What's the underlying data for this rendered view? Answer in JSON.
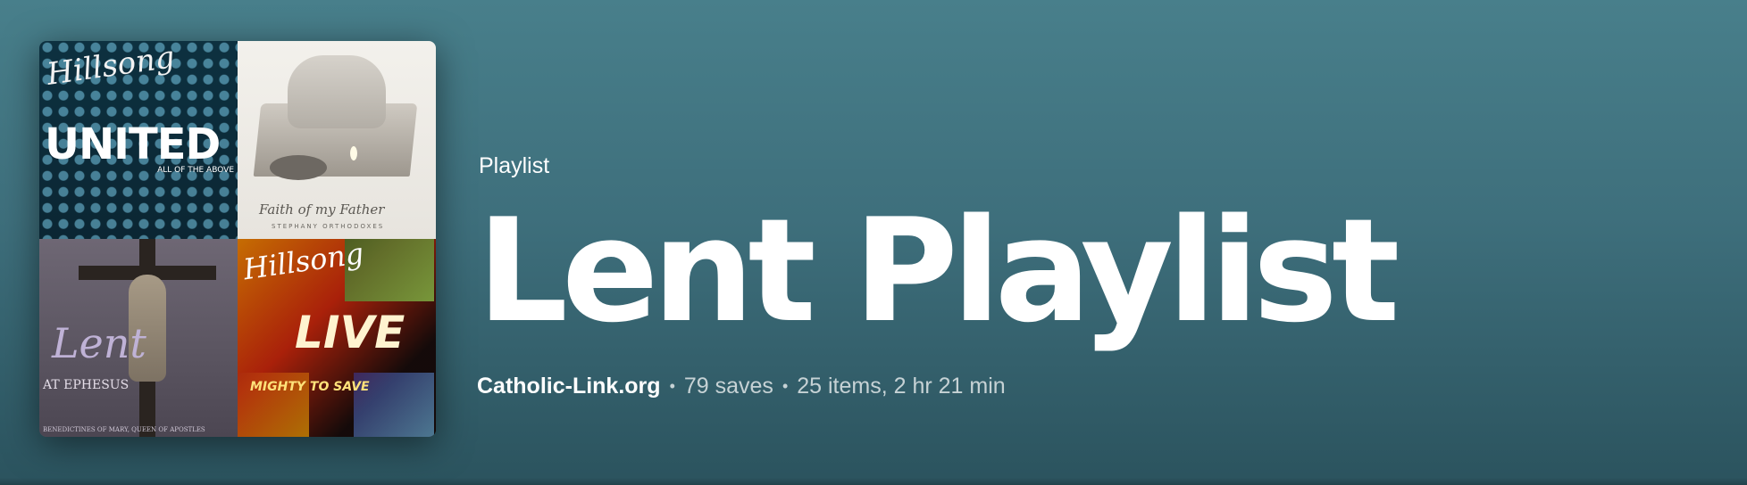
{
  "playlist": {
    "type_label": "Playlist",
    "title": "Lent Playlist",
    "owner": "Catholic-Link.org",
    "saves": "79 saves",
    "items_duration": "25 items, 2 hr 21 min",
    "separator": "•"
  },
  "cover": {
    "tiles": [
      {
        "brand": "Hillsong",
        "title": "UNITED",
        "subtitle": "ALL OF THE ABOVE"
      },
      {
        "title": "Faith of my Father",
        "artist": "STEPHANY ORTHODOXES"
      },
      {
        "title": "Lent",
        "subtitle": "AT EPHESUS",
        "footer": "BENEDICTINES OF MARY, QUEEN OF APOSTLES"
      },
      {
        "brand": "Hillsong",
        "title": "LIVE",
        "subtitle": "MIGHTY TO SAVE"
      }
    ]
  },
  "colors": {
    "header_gradient_top": "#487f8b",
    "header_gradient_bottom": "#2b535e",
    "text_primary": "#ffffff"
  }
}
